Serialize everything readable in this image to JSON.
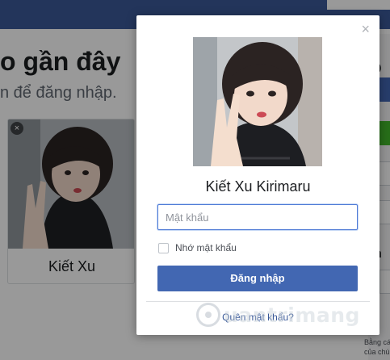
{
  "background": {
    "title": "o gần đây",
    "subtitle": "n để đăng nhập.",
    "card": {
      "close_glyph": "×",
      "name": "Kiết Xu"
    },
    "right": {
      "title_fragment": "o",
      "label_fragment": "n",
      "footnote_line1": "Bằng cách nhấ",
      "footnote_line2": "của chúng tôi v"
    }
  },
  "modal": {
    "close_glyph": "×",
    "name": "Kiết Xu Kirimaru",
    "password_placeholder": "Mật khẩu",
    "remember_label": "Nhớ mật khẩu",
    "login_label": "Đăng nhập",
    "forgot_label": "Quên mật khẩu?"
  },
  "watermark": {
    "text": "uantrimang"
  },
  "colors": {
    "brand": "#3b5998",
    "button": "#4267b2",
    "link": "#385898"
  }
}
